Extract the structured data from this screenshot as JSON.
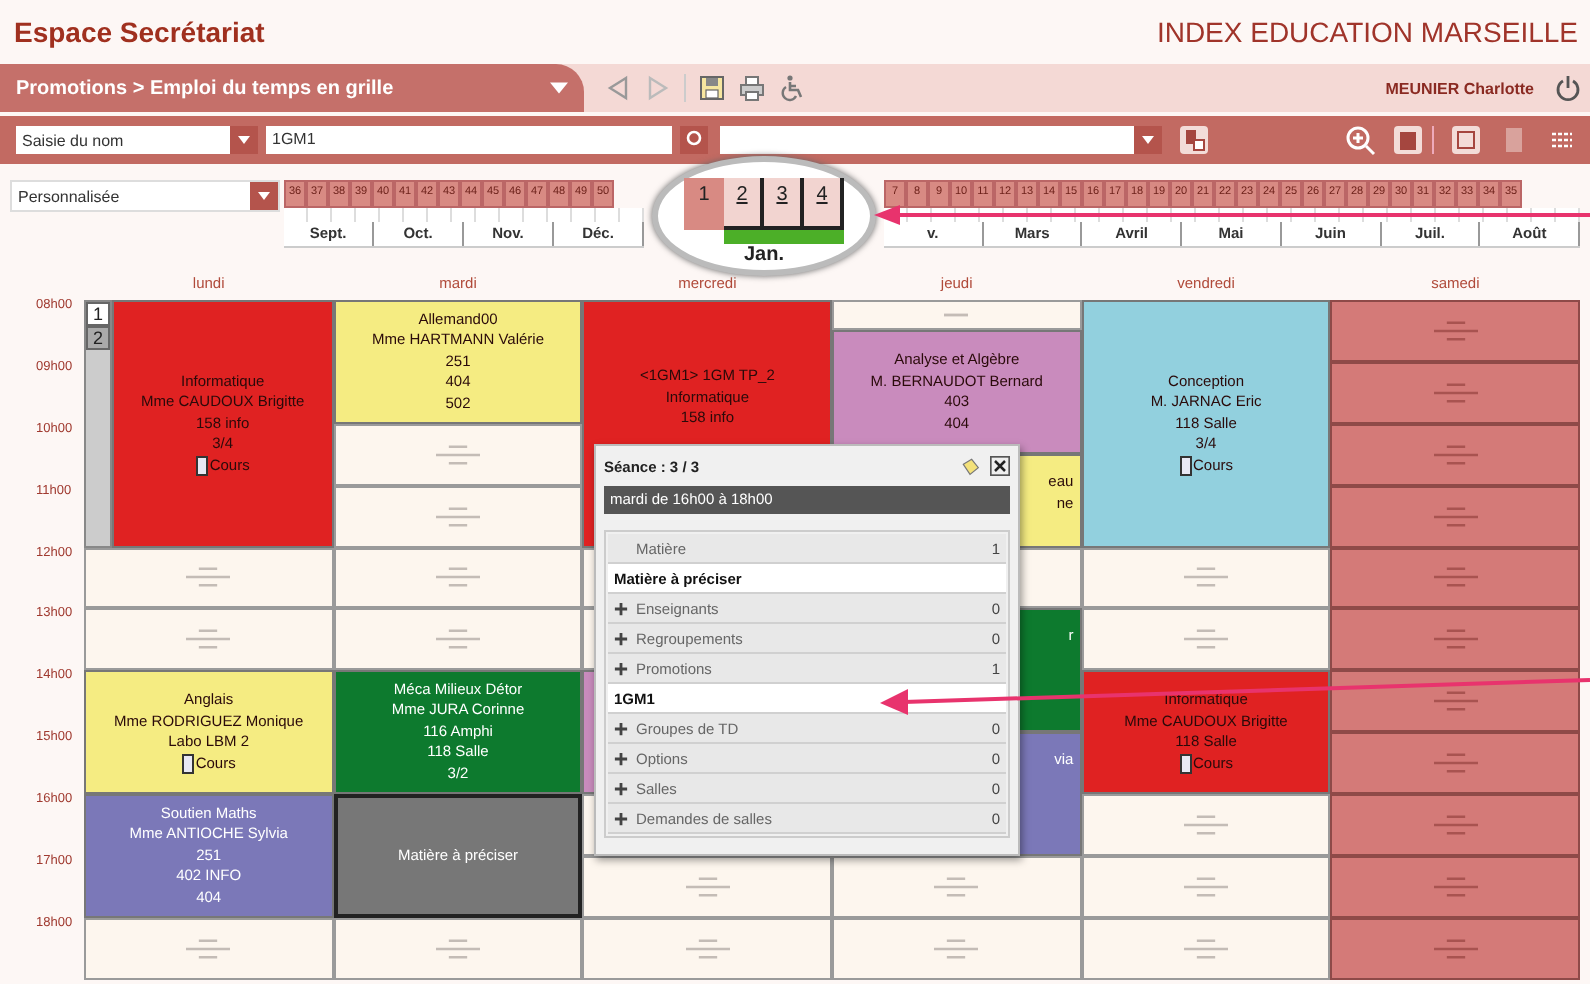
{
  "header": {
    "title": "Espace Secrétariat",
    "organization": "INDEX EDUCATION MARSEILLE"
  },
  "nav": {
    "breadcrumb": "Promotions > Emploi du temps en grille",
    "user": "MEUNIER Charlotte"
  },
  "toolbar": {
    "mode_select": "Saisie du nom",
    "search_value": "1GM1"
  },
  "period": {
    "select": "Personnalisée",
    "weeks_before": [
      {
        "label": "36",
        "selected": false
      },
      {
        "label": "37",
        "selected": false
      },
      {
        "label": "38",
        "selected": false
      },
      {
        "label": "39",
        "selected": false
      },
      {
        "label": "40",
        "selected": false
      },
      {
        "label": "41",
        "selected": false
      },
      {
        "label": "42",
        "selected": false
      },
      {
        "label": "43",
        "selected": false
      },
      {
        "label": "44",
        "selected": false
      },
      {
        "label": "45",
        "selected": false
      },
      {
        "label": "46",
        "selected": false
      },
      {
        "label": "47",
        "selected": false
      },
      {
        "label": "48",
        "selected": false
      },
      {
        "label": "49",
        "selected": false
      },
      {
        "label": "50",
        "selected": false
      }
    ],
    "months_before": [
      "Sept.",
      "Oct.",
      "Nov.",
      "Déc."
    ],
    "lens": {
      "weeks": [
        {
          "label": "1",
          "selected": false
        },
        {
          "label": "2",
          "selected": true
        },
        {
          "label": "3",
          "selected": true
        },
        {
          "label": "4",
          "selected": true
        }
      ],
      "month": "Jan."
    },
    "weeks_after": [
      {
        "label": "7",
        "selected": false
      },
      {
        "label": "8",
        "selected": false
      },
      {
        "label": "9",
        "selected": false
      },
      {
        "label": "10",
        "selected": false
      },
      {
        "label": "11",
        "selected": false
      },
      {
        "label": "12",
        "selected": false
      },
      {
        "label": "13",
        "selected": false
      },
      {
        "label": "14",
        "selected": false
      },
      {
        "label": "15",
        "selected": false
      },
      {
        "label": "16",
        "selected": false
      },
      {
        "label": "17",
        "selected": false
      },
      {
        "label": "18",
        "selected": false
      },
      {
        "label": "19",
        "selected": false
      },
      {
        "label": "20",
        "selected": false
      },
      {
        "label": "21",
        "selected": false
      },
      {
        "label": "22",
        "selected": false
      },
      {
        "label": "23",
        "selected": false
      },
      {
        "label": "24",
        "selected": false
      },
      {
        "label": "25",
        "selected": false
      },
      {
        "label": "26",
        "selected": false
      },
      {
        "label": "27",
        "selected": false
      },
      {
        "label": "28",
        "selected": false
      },
      {
        "label": "29",
        "selected": false
      },
      {
        "label": "30",
        "selected": false
      },
      {
        "label": "31",
        "selected": false
      },
      {
        "label": "32",
        "selected": false
      },
      {
        "label": "33",
        "selected": false
      },
      {
        "label": "34",
        "selected": false
      },
      {
        "label": "35",
        "selected": false
      }
    ],
    "months_after": [
      "v.",
      "Mars",
      "Avril",
      "Mai",
      "Juin",
      "Juil.",
      "Août"
    ]
  },
  "hours": [
    "08h00",
    "09h00",
    "10h00",
    "11h00",
    "12h00",
    "13h00",
    "14h00",
    "15h00",
    "16h00",
    "17h00",
    "18h00"
  ],
  "days": [
    {
      "name": "lundi",
      "unavailable": false,
      "slots": [
        {
          "kind": "quad",
          "color": "#e02222",
          "light_text": false,
          "selected": false,
          "lines": [
            "Informatique",
            "Mme CAUDOUX Brigitte",
            "158 info",
            "3/4"
          ],
          "tag": "Cours",
          "tabs": [
            {
              "label": "1",
              "selected": true
            },
            {
              "label": "2",
              "selected": false
            }
          ]
        },
        {
          "kind": "hour"
        },
        {
          "kind": "hour"
        },
        {
          "kind": "double",
          "color": "#f5ec82",
          "light_text": false,
          "selected": false,
          "lines": [
            "Anglais",
            "Mme RODRIGUEZ Monique",
            "Labo LBM 2"
          ],
          "tag": "Cours"
        },
        {
          "kind": "double",
          "color": "#7b78b8",
          "light_text": true,
          "selected": false,
          "lines": [
            "Soutien Maths",
            "Mme ANTIOCHE Sylvia",
            "251",
            "402 INFO",
            "404"
          ]
        },
        {
          "kind": "hour"
        }
      ]
    },
    {
      "name": "mardi",
      "unavailable": false,
      "slots": [
        {
          "kind": "double",
          "color": "#f5ec82",
          "light_text": false,
          "selected": false,
          "lines": [
            "Allemand00",
            "Mme HARTMANN Valérie",
            "251",
            "404",
            "502"
          ]
        },
        {
          "kind": "hour"
        },
        {
          "kind": "hour"
        },
        {
          "kind": "hour"
        },
        {
          "kind": "hour"
        },
        {
          "kind": "double",
          "color": "#0d7a2e",
          "light_text": true,
          "selected": false,
          "lines": [
            "Méca Milieux Détor",
            "Mme JURA Corinne",
            "116 Amphi",
            "118 Salle",
            "3/2"
          ]
        },
        {
          "kind": "double",
          "color": "#777777",
          "light_text": true,
          "selected": true,
          "lines": [
            "Matière à préciser"
          ]
        },
        {
          "kind": "hour"
        }
      ]
    },
    {
      "name": "mercredi",
      "unavailable": false,
      "slots": [
        {
          "kind": "quad",
          "color": "#e02222",
          "light_text": false,
          "selected": false,
          "cut_below": true,
          "lines": [
            "<1GM1> 1GM TP_2",
            "Informatique",
            "158 info"
          ]
        },
        {
          "kind": "hour",
          "covered": true
        },
        {
          "kind": "hour",
          "covered": true
        },
        {
          "kind": "double",
          "color": "#c98bbd",
          "selected": false
        },
        {
          "kind": "hour",
          "covered": true
        },
        {
          "kind": "hour"
        },
        {
          "kind": "hour"
        }
      ]
    },
    {
      "name": "jeudi",
      "unavailable": false,
      "slots": [
        {
          "kind": "half"
        },
        {
          "kind": "double",
          "color": "#c98bbd",
          "light_text": false,
          "selected": false,
          "lines": [
            "Analyse et Algèbre",
            "M. BERNAUDOT Bernard",
            "403",
            "404"
          ]
        },
        {
          "kind": "hour_half",
          "color": "#f5ec82",
          "light_text": false,
          "selected": false,
          "cut_right": true,
          "lines": [
            "eau",
            "ne"
          ]
        },
        {
          "kind": "hour",
          "covered": true
        },
        {
          "kind": "double",
          "color": "#0d7a2e",
          "light_text": true,
          "selected": false,
          "cut_right": true,
          "lines": [
            "r"
          ]
        },
        {
          "kind": "double",
          "color": "#7b78b8",
          "light_text": true,
          "selected": false,
          "cut_right": true,
          "lines": [
            "via"
          ]
        },
        {
          "kind": "hour"
        },
        {
          "kind": "hour"
        }
      ]
    },
    {
      "name": "vendredi",
      "unavailable": false,
      "slots": [
        {
          "kind": "quad",
          "color": "#92d0de",
          "light_text": false,
          "selected": false,
          "lines": [
            "Conception",
            "M. JARNAC Eric",
            "118 Salle",
            "3/4"
          ],
          "tag": "Cours"
        },
        {
          "kind": "hour"
        },
        {
          "kind": "hour"
        },
        {
          "kind": "double",
          "color": "#e02222",
          "light_text": false,
          "selected": false,
          "lines": [
            "Informatique",
            "Mme CAUDOUX Brigitte",
            "118 Salle"
          ],
          "tag": "Cours"
        },
        {
          "kind": "hour"
        },
        {
          "kind": "hour"
        },
        {
          "kind": "hour"
        }
      ]
    },
    {
      "name": "samedi",
      "unavailable": true,
      "slots": [
        {
          "kind": "hour"
        },
        {
          "kind": "hour"
        },
        {
          "kind": "hour"
        },
        {
          "kind": "hour"
        },
        {
          "kind": "hour"
        },
        {
          "kind": "hour"
        },
        {
          "kind": "hour"
        },
        {
          "kind": "hour"
        },
        {
          "kind": "hour"
        },
        {
          "kind": "hour"
        },
        {
          "kind": "hour"
        }
      ]
    }
  ],
  "popup": {
    "title": "Séance : 3 / 3",
    "time": "mardi de 16h00 à 18h00",
    "rows": [
      {
        "kind": "header",
        "label": "Matière",
        "count": "1"
      },
      {
        "kind": "value",
        "label": "Matière à préciser"
      },
      {
        "kind": "category",
        "label": "Enseignants",
        "count": "0"
      },
      {
        "kind": "category",
        "label": "Regroupements",
        "count": "0"
      },
      {
        "kind": "category",
        "label": "Promotions",
        "count": "1"
      },
      {
        "kind": "value",
        "label": "1GM1"
      },
      {
        "kind": "category",
        "label": "Groupes de TD",
        "count": "0"
      },
      {
        "kind": "category",
        "label": "Options",
        "count": "0"
      },
      {
        "kind": "category",
        "label": "Salles",
        "count": "0"
      },
      {
        "kind": "category",
        "label": "Demandes de salles",
        "count": "0"
      }
    ]
  }
}
